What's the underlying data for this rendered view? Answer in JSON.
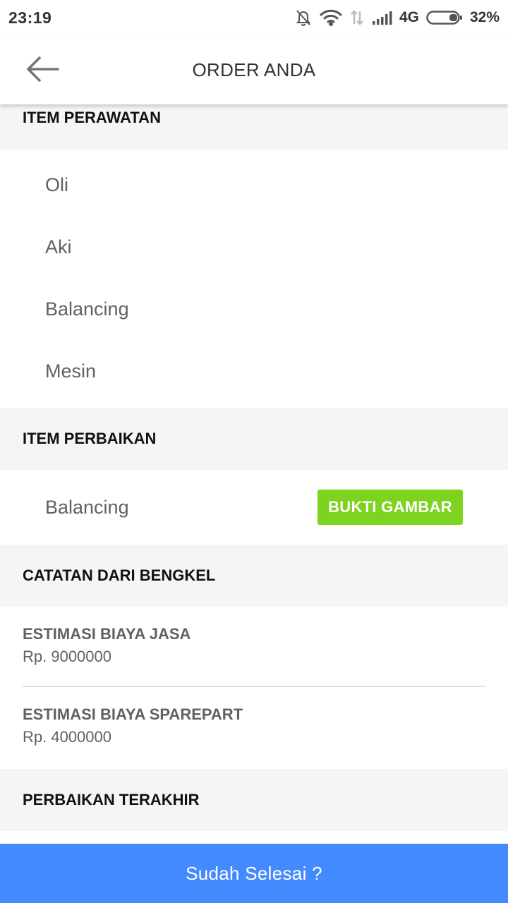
{
  "status_bar": {
    "time": "23:19",
    "network": "4G",
    "battery": "32%",
    "icons": [
      "bell-off-icon",
      "wifi-icon",
      "data-arrows-icon",
      "signal-icon",
      "battery-icon"
    ]
  },
  "app_bar": {
    "title": "ORDER ANDA",
    "back_icon": "arrow-left-icon"
  },
  "sections": {
    "perawatan": {
      "title": "ITEM PERAWATAN",
      "items": [
        "Oli",
        "Aki",
        "Balancing",
        "Mesin"
      ]
    },
    "perbaikan": {
      "title": "ITEM PERBAIKAN",
      "items": [
        {
          "label": "Balancing",
          "button": "BUKTI GAMBAR"
        }
      ]
    },
    "catatan": {
      "title": "CATATAN DARI BENGKEL",
      "entries": [
        {
          "label": "ESTIMASI BIAYA JASA",
          "value": "Rp. 9000000"
        },
        {
          "label": "ESTIMASI BIAYA SPAREPART",
          "value": "Rp. 4000000"
        }
      ]
    },
    "terakhir": {
      "title": "PERBAIKAN TERAKHIR"
    }
  },
  "bottom_button": {
    "label": "Sudah Selesai ?"
  },
  "colors": {
    "accent_blue": "#448aff",
    "accent_green": "#7ed321",
    "section_bg": "#f5f5f5",
    "item_text": "#616161"
  }
}
